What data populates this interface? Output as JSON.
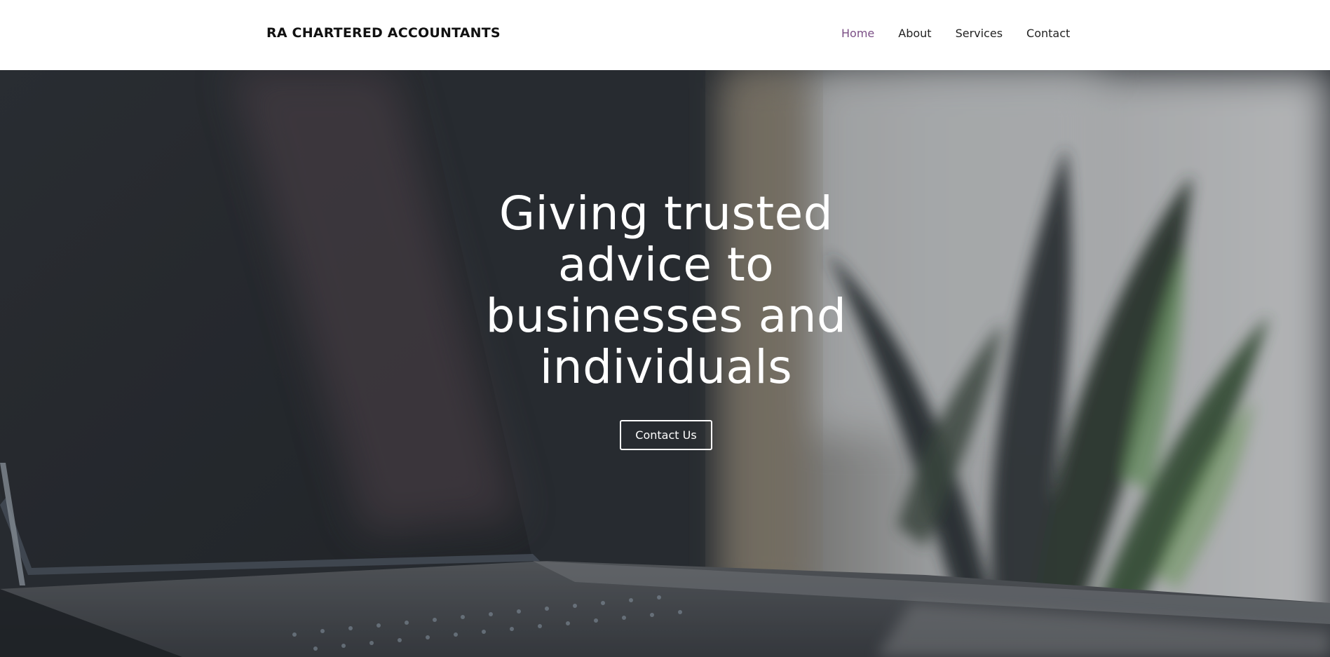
{
  "header": {
    "brand": "RA CHARTERED ACCOUNTANTS",
    "nav": [
      {
        "label": "Home",
        "active": true
      },
      {
        "label": "About",
        "active": false
      },
      {
        "label": "Services",
        "active": false
      },
      {
        "label": "Contact",
        "active": false
      }
    ]
  },
  "hero": {
    "title": "Giving trusted advice to businesses and individuals",
    "cta_label": "Contact Us",
    "background": "hero-background-image-laptop-and-plant"
  },
  "colors": {
    "nav_active": "#7b4f86",
    "hero_dark": "#2a2f34",
    "text_white": "#ffffff"
  }
}
